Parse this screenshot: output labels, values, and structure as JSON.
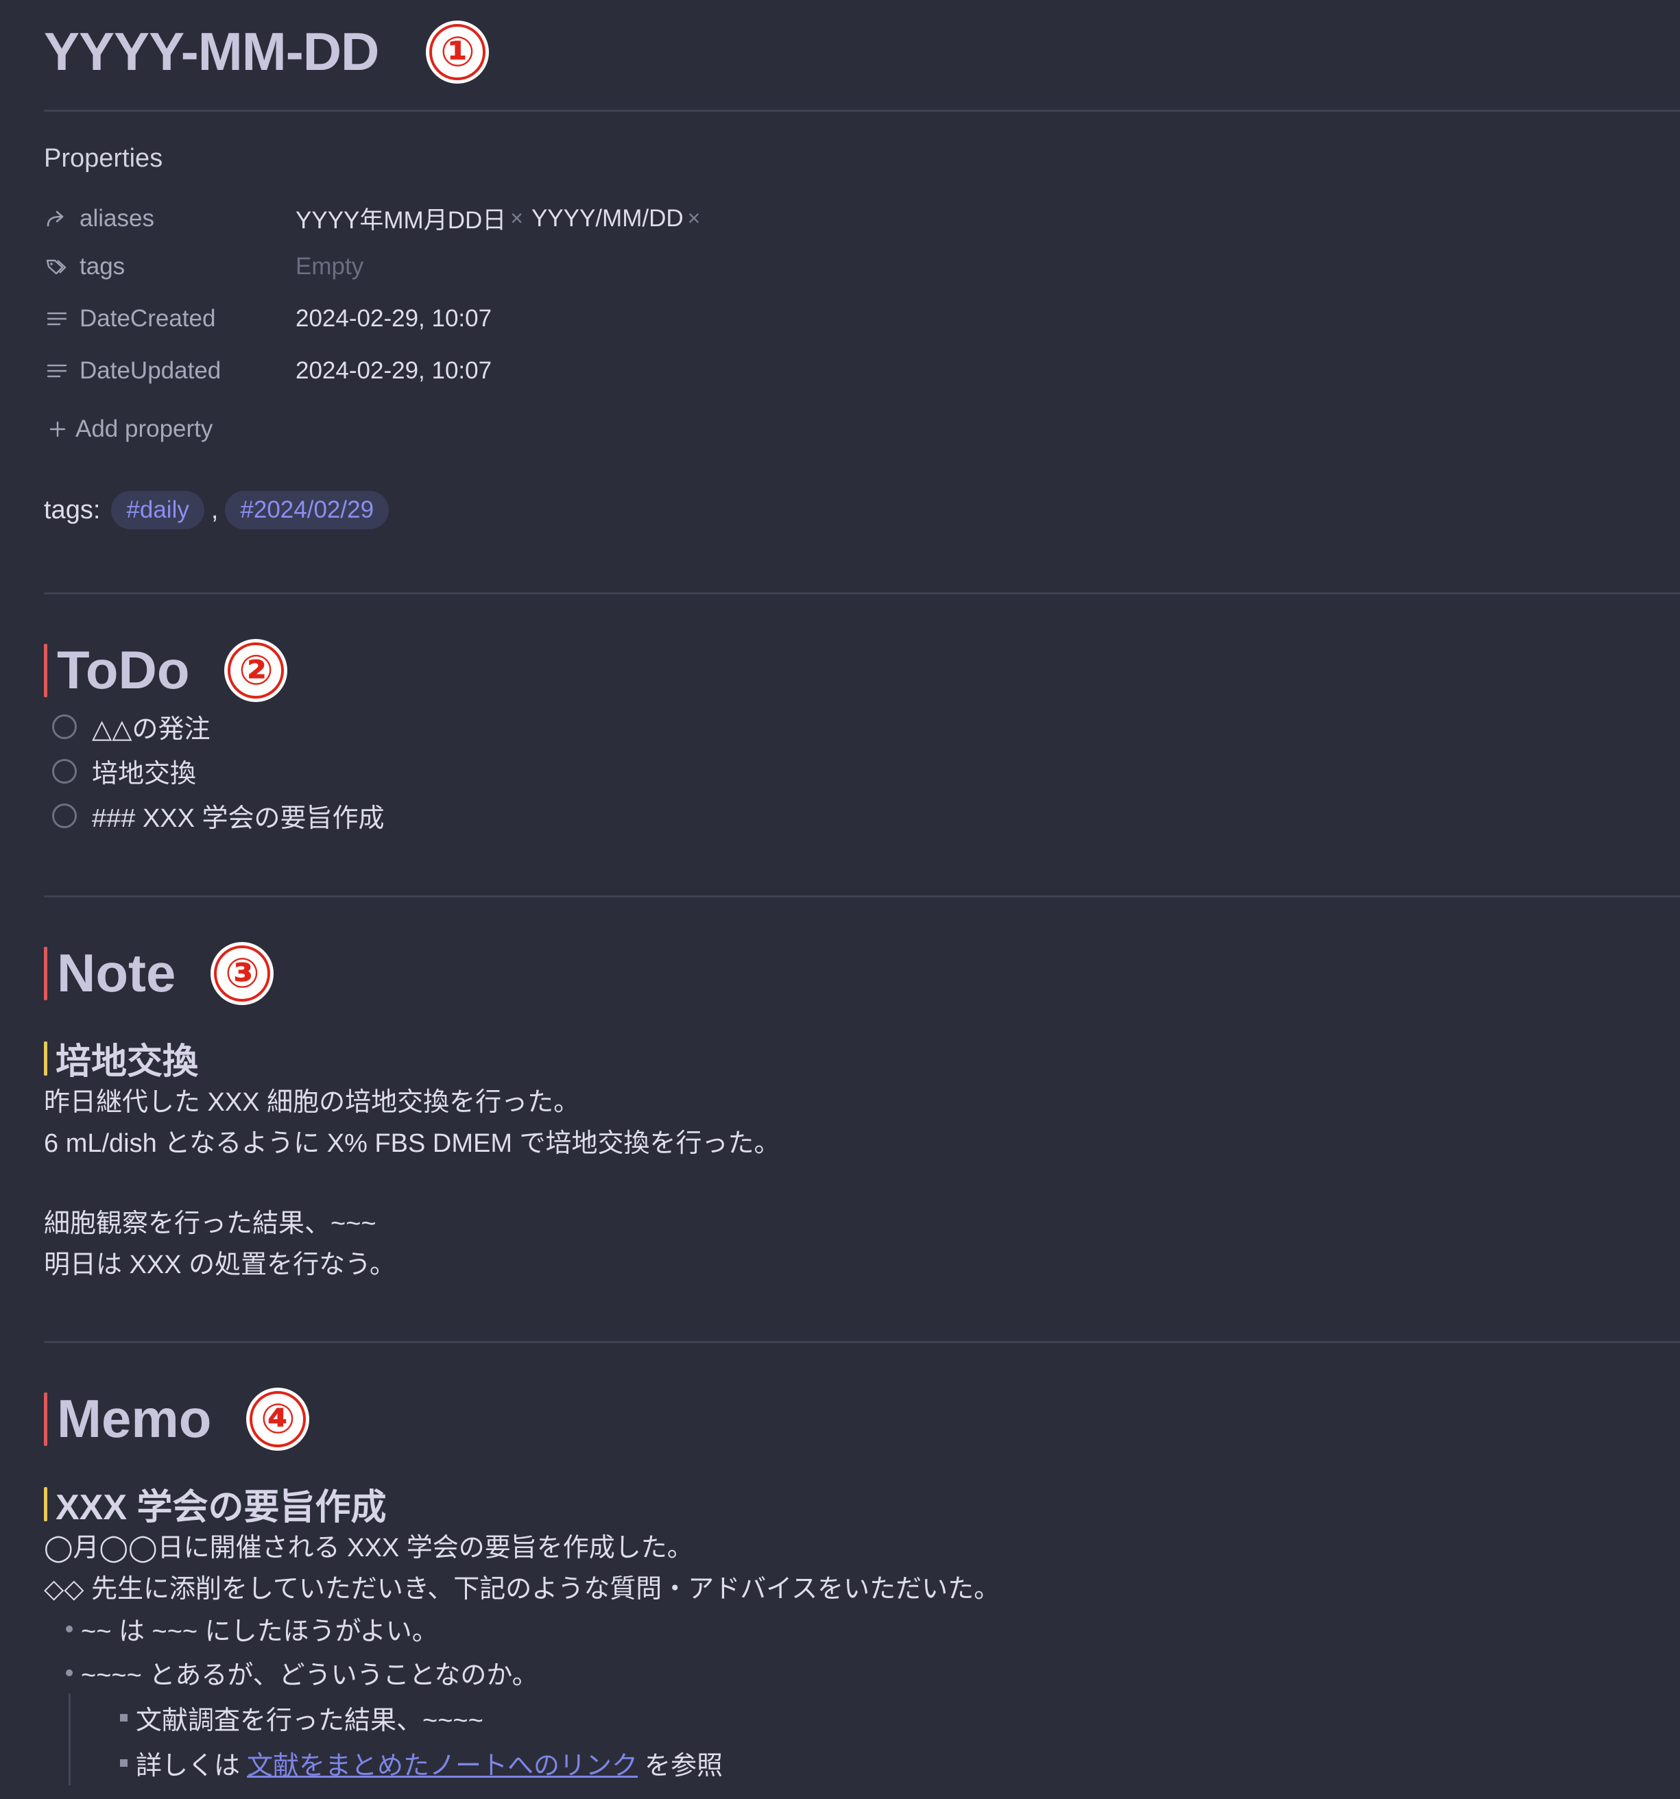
{
  "document": {
    "title": "YYYY-MM-DD",
    "badges": [
      "①",
      "②",
      "③",
      "④"
    ]
  },
  "properties": {
    "heading": "Properties",
    "rows": [
      {
        "icon": "link-arrow-icon",
        "key": "aliases",
        "values": [
          "YYYY年MM月DD日",
          "YYYY/MM/DD"
        ]
      },
      {
        "icon": "tags-icon",
        "key": "tags",
        "value": "Empty"
      },
      {
        "icon": "text-lines-icon",
        "key": "DateCreated",
        "value": "2024-02-29, 10:07"
      },
      {
        "icon": "text-lines-icon",
        "key": "DateUpdated",
        "value": "2024-02-29, 10:07"
      }
    ],
    "remove_glyph": "×",
    "add_label": "Add property"
  },
  "tags_line": {
    "label": "tags:",
    "separator": ",",
    "tags": [
      "#daily",
      "#2024/02/29"
    ]
  },
  "todo": {
    "heading": "ToDo",
    "items": [
      "△△の発注",
      "培地交換",
      "### XXX 学会の要旨作成"
    ]
  },
  "note": {
    "heading": "Note",
    "subheading": "培地交換",
    "lines": [
      "昨日継代した XXX 細胞の培地交換を行った。",
      "6 mL/dish となるように X% FBS DMEM で培地交換を行った。",
      "細胞観察を行った結果、~~~",
      "明日は XXX の処置を行なう。"
    ]
  },
  "memo": {
    "heading": "Memo",
    "subheading": "XXX 学会の要旨作成",
    "lines": [
      "◯月◯◯日に開催される XXX 学会の要旨を作成した。",
      "◇◇ 先生に添削をしていただいき、下記のような質問・アドバイスをいただいた。"
    ],
    "bullets": [
      "~~ は ~~~ にしたほうがよい。",
      "~~~~ とあるが、どういうことなのか。"
    ],
    "sub_bullets": {
      "first": "文献調査を行った結果、~~~~",
      "second_prefix": "詳しくは",
      "second_link": "文献をまとめたノートへのリンク",
      "second_suffix": "を参照"
    }
  }
}
